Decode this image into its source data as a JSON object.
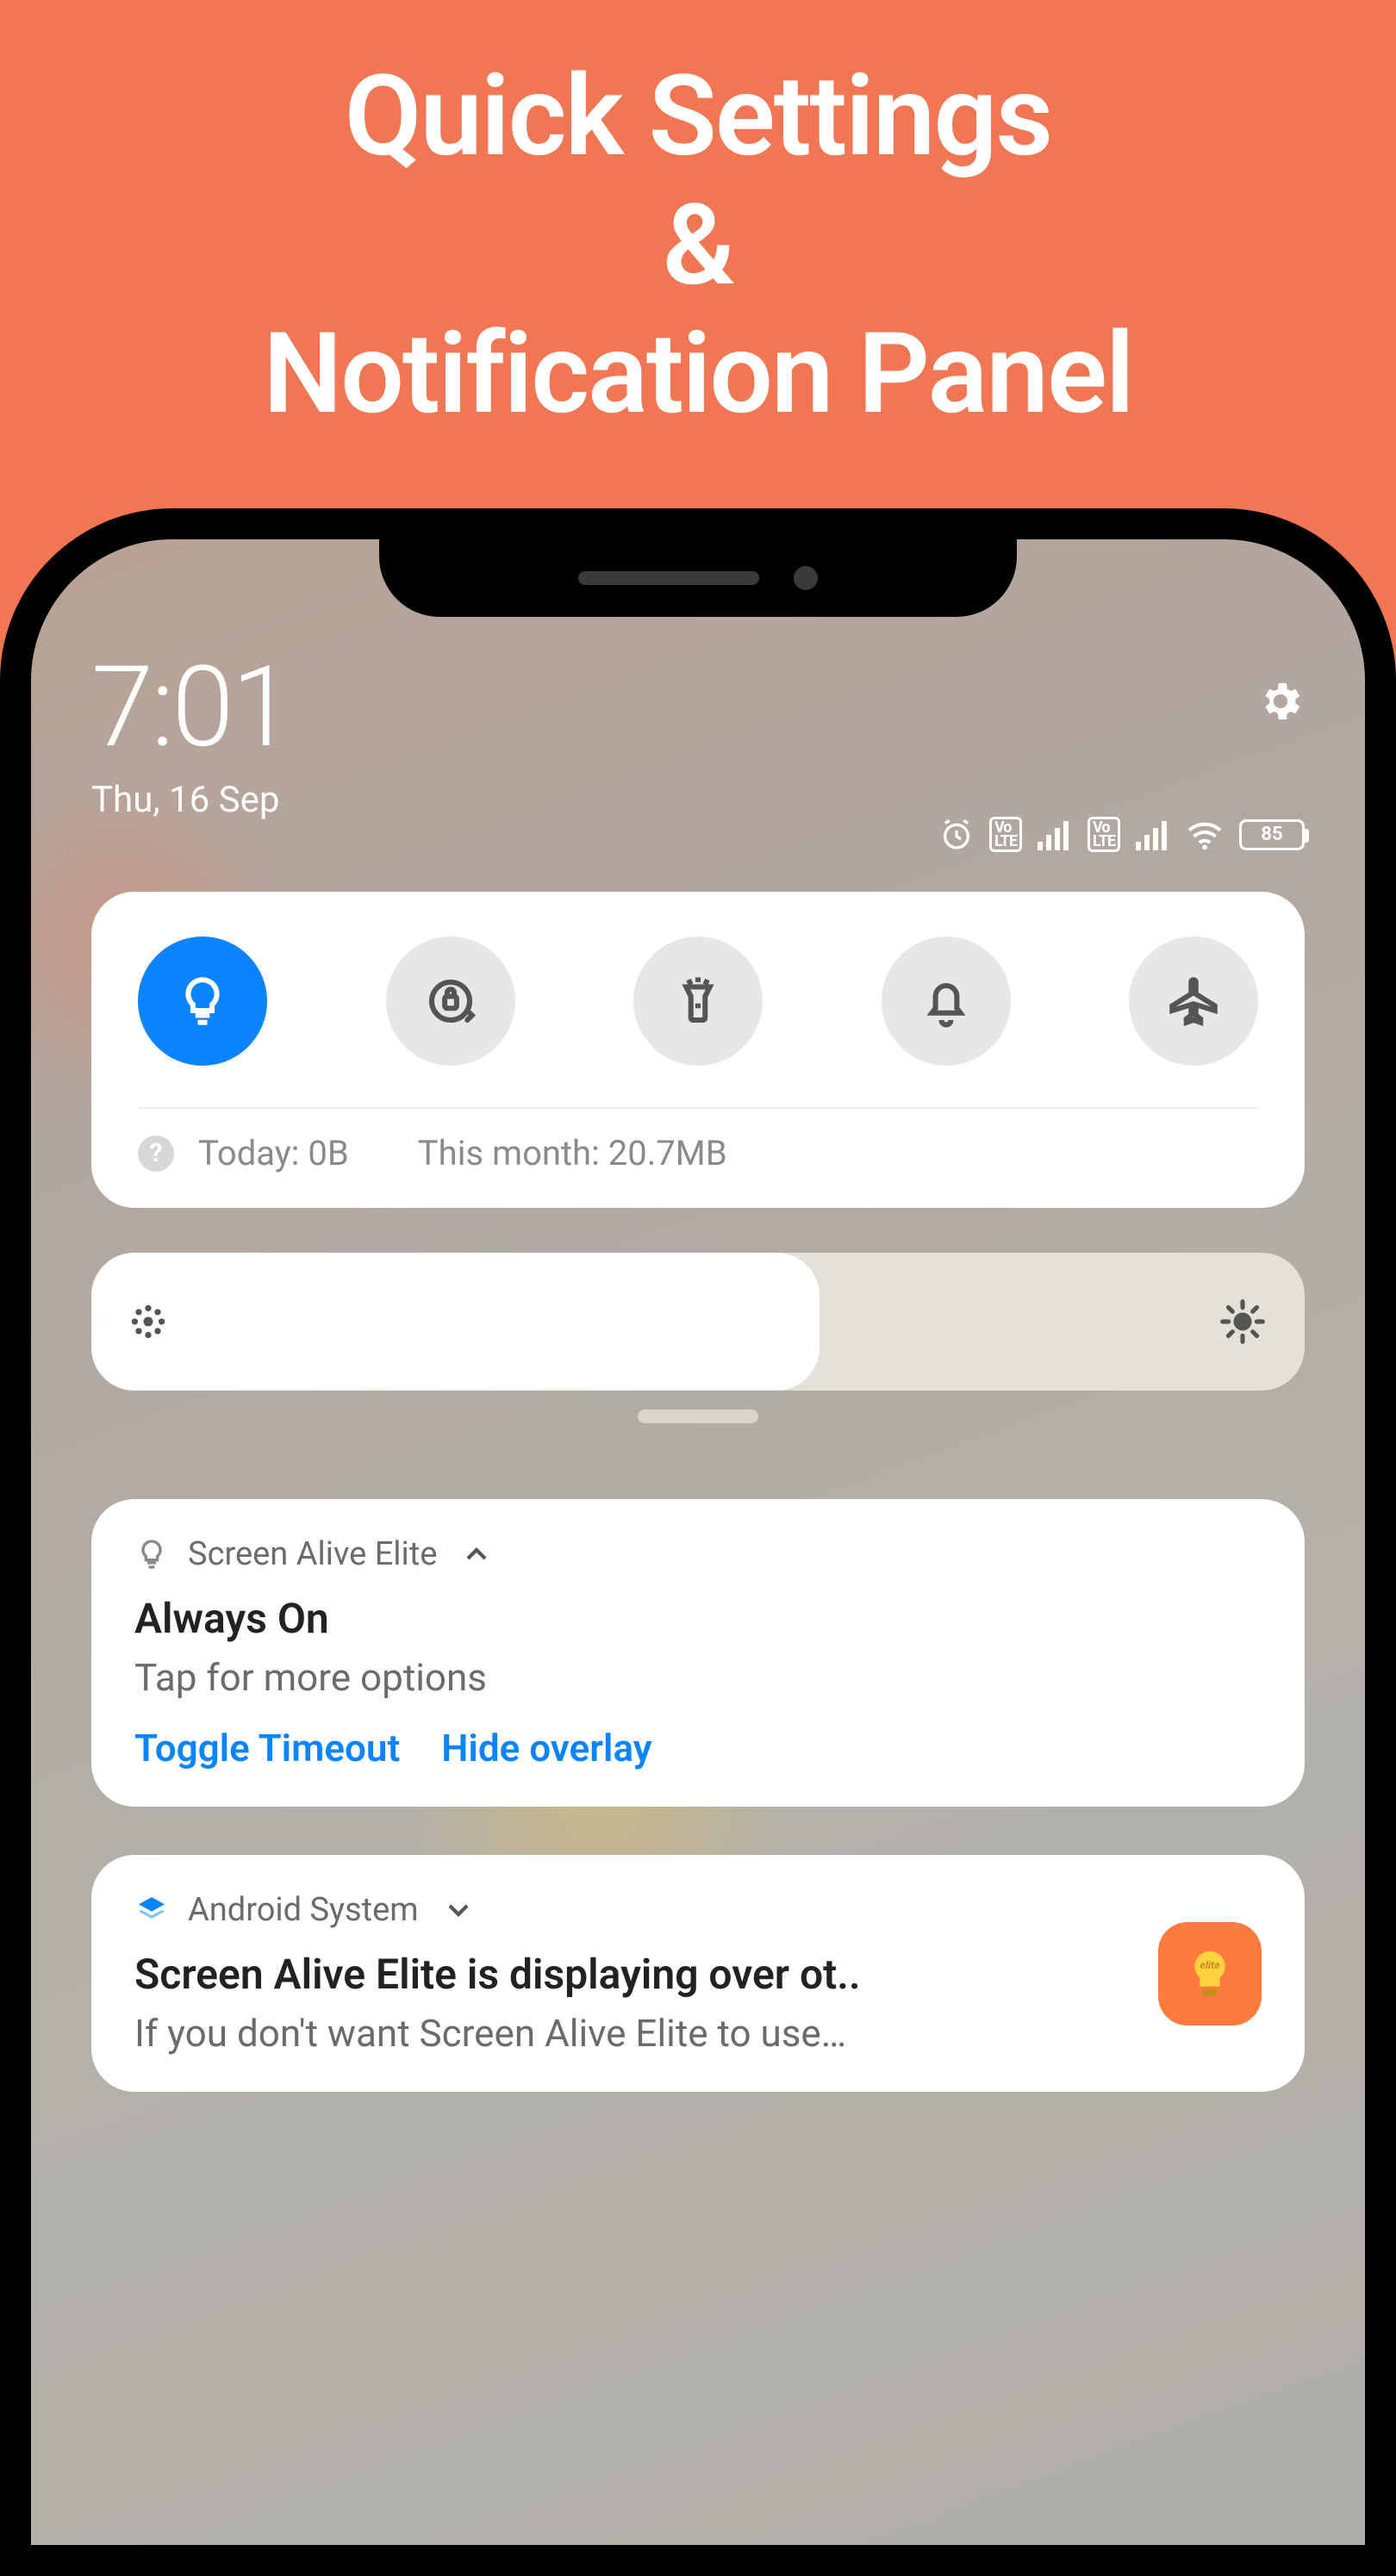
{
  "hero": {
    "line1": "Quick Settings",
    "line2": "&",
    "line3": "Notification Panel"
  },
  "status": {
    "time": "7:01",
    "date": "Thu, 16 Sep",
    "battery": "85"
  },
  "quick_settings": {
    "tiles": [
      {
        "name": "light-bulb",
        "active": true
      },
      {
        "name": "rotation-lock",
        "active": false
      },
      {
        "name": "flashlight",
        "active": false
      },
      {
        "name": "dnd-bell",
        "active": false
      },
      {
        "name": "airplane-mode",
        "active": false
      }
    ],
    "data_today_label": "Today:",
    "data_today_value": "0B",
    "data_month_label": "This month:",
    "data_month_value": "20.7MB"
  },
  "brightness": {
    "percent": 60
  },
  "notifications": [
    {
      "app": "Screen Alive Elite",
      "title": "Always On",
      "subtitle": "Tap for more options",
      "actions": [
        "Toggle Timeout",
        "Hide overlay"
      ]
    },
    {
      "app": "Android System",
      "title": "Screen Alive Elite is displaying over ot..",
      "subtitle": "If you don't want Screen Alive Elite to use…"
    }
  ]
}
